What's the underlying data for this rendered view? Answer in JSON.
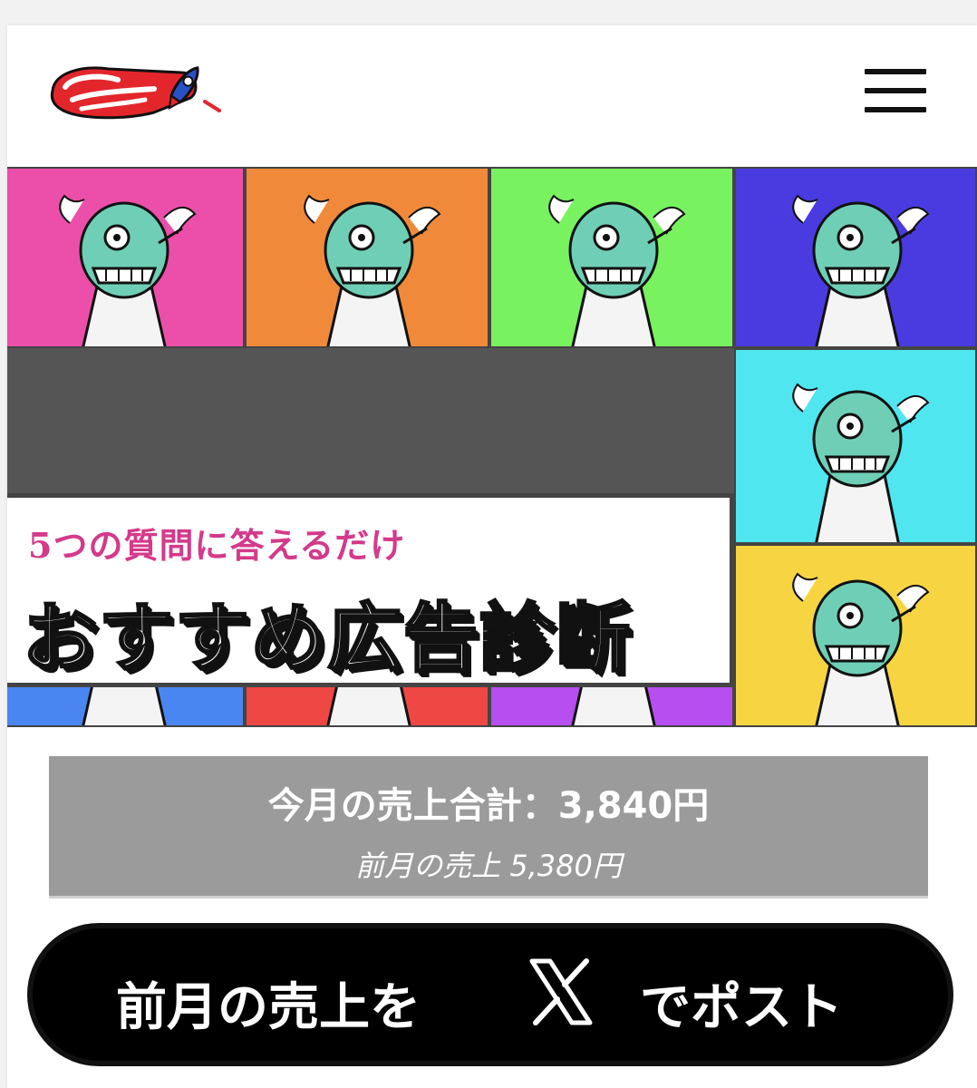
{
  "header": {
    "logo_icon": "oddpotato-rocket-logo",
    "menu_icon": "hamburger-menu-icon"
  },
  "banner": {
    "subtitle": "5つの質問に答えるだけ",
    "title": "おすすめ広告診断",
    "tile_colors": [
      "#ec4fa9",
      "#f08a3a",
      "#79f25f",
      "#4a3be0",
      "#4fe6f0",
      "#4a86f2",
      "#ef4744",
      "#b64ef0",
      "#f7d542"
    ]
  },
  "sales": {
    "current": "今月の売上合計：3,840円",
    "previous": "前月の売上 5,380円"
  },
  "post_button": {
    "label_before": "前月の売上を",
    "label_after": "でポスト",
    "icon": "x-logo-icon"
  }
}
